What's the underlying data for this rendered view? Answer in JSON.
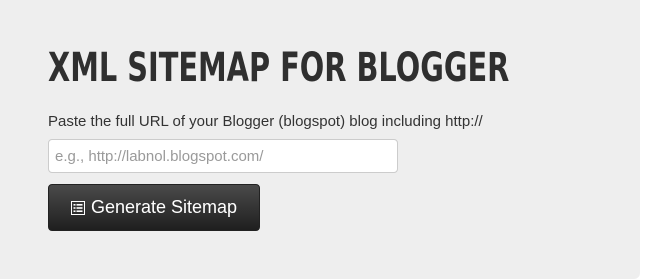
{
  "header": {
    "title": "XML SITEMAP FOR BLOGGER"
  },
  "form": {
    "instructions": "Paste the full URL of your Blogger (blogspot) blog including http://",
    "url_placeholder": "e.g., http://labnol.blogspot.com/",
    "url_value": "",
    "generate_label": "Generate Sitemap",
    "generate_icon": "list-icon"
  }
}
